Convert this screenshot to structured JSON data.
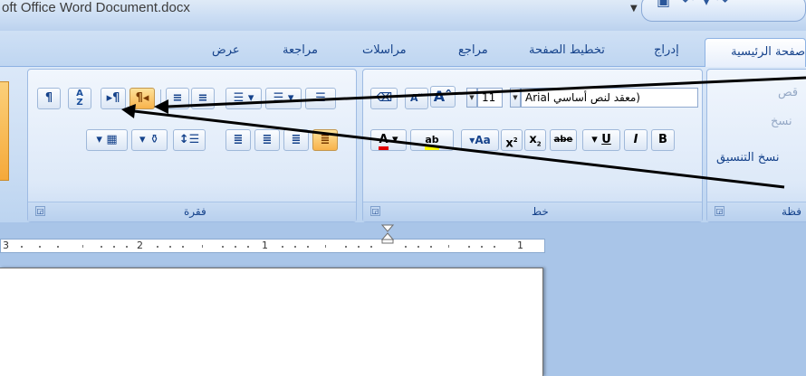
{
  "window": {
    "title": "oft Office Word Document.docx",
    "qat_dropdown_icon": "chevron-down-icon"
  },
  "tabs": {
    "home": "صفحة الرئيسية",
    "insert": "إدراج",
    "page_layout": "تخطيط الصفحة",
    "references": "مراجع",
    "mailings": "مراسلات",
    "review": "مراجعة",
    "view": "عرض"
  },
  "clipboard": {
    "cut": "قص",
    "copy": "نسخ",
    "format_painter": "نسخ التنسيق",
    "group_label": "فظة"
  },
  "font": {
    "style_box": "معقد لنص أساسي)",
    "font_name": "Arial",
    "font_size": "11",
    "grow_label": "A",
    "shrink_label": "A",
    "bold": "B",
    "italic": "I",
    "underline": "U",
    "strike": "abe",
    "subscript": "x",
    "superscript": "x",
    "change_case": "Aa",
    "highlight": "ab",
    "font_color": "A",
    "group_label": "خط"
  },
  "paragraph": {
    "pilcrow": "¶",
    "sort": "A Z",
    "ltr_label": "¶",
    "rtl_label": "¶",
    "group_label": "فقرة"
  },
  "ruler": {
    "numbers": [
      "3",
      "2",
      "1",
      "1"
    ]
  },
  "colors": {
    "highlight_orange": "#f8b24b",
    "ribbon_blue": "#dde9f8",
    "text_blue": "#15428b",
    "font_color_red": "#e00000",
    "highlight_yellow": "#ffff00"
  }
}
